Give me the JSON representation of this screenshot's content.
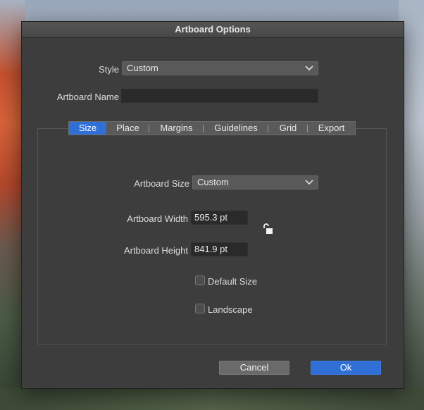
{
  "dialog": {
    "title": "Artboard Options"
  },
  "style": {
    "label": "Style",
    "value": "Custom"
  },
  "artboard_name": {
    "label": "Artboard Name",
    "value": ""
  },
  "tabs": [
    {
      "label": "Size",
      "active": true
    },
    {
      "label": "Place",
      "active": false
    },
    {
      "label": "Margins",
      "active": false
    },
    {
      "label": "Guidelines",
      "active": false
    },
    {
      "label": "Grid",
      "active": false
    },
    {
      "label": "Export",
      "active": false
    }
  ],
  "size": {
    "artboard_size": {
      "label": "Artboard Size",
      "value": "Custom"
    },
    "width": {
      "label": "Artboard Width",
      "value": "595.3 pt"
    },
    "height": {
      "label": "Artboard Height",
      "value": "841.9 pt"
    },
    "default_size": {
      "label": "Default Size",
      "checked": false
    },
    "landscape": {
      "label": "Landscape",
      "checked": false
    },
    "lock_icon": "unlocked-padlock-icon"
  },
  "buttons": {
    "cancel": "Cancel",
    "ok": "Ok"
  },
  "colors": {
    "accent": "#2f6fd6",
    "dialog_bg": "#3d3d3d"
  }
}
